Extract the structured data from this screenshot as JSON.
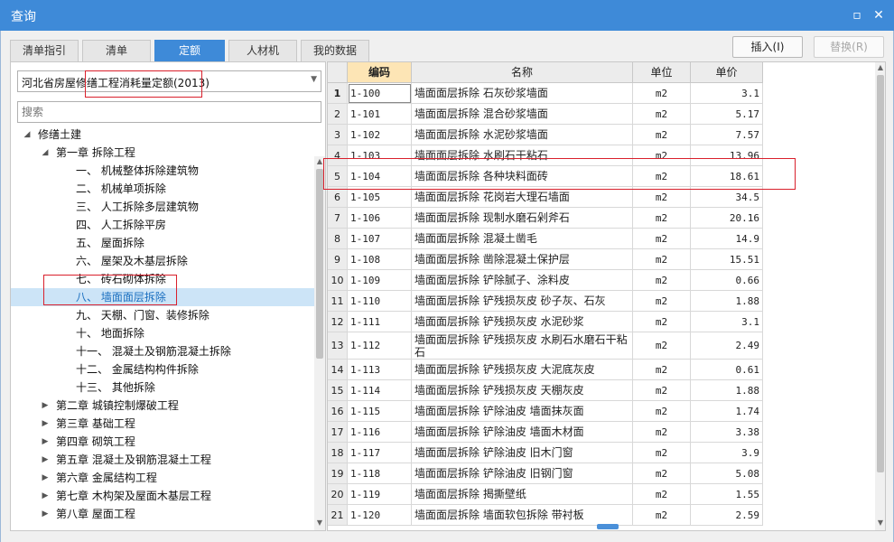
{
  "window": {
    "title": "查询",
    "restore_glyph": "▫",
    "close_glyph": "✕"
  },
  "tabs": [
    {
      "label": "清单指引",
      "active": false
    },
    {
      "label": "清单",
      "active": false
    },
    {
      "label": "定额",
      "active": true
    },
    {
      "label": "人材机",
      "active": false
    },
    {
      "label": "我的数据",
      "active": false
    }
  ],
  "actions": {
    "insert_label": "插入(I)",
    "replace_label": "替换(R)"
  },
  "left": {
    "quota_select": "河北省房屋修缮工程消耗量定额(2013)",
    "search_placeholder": "搜索",
    "tree": [
      {
        "label": "修缮土建",
        "level": 0,
        "expander": "◢"
      },
      {
        "label": "第一章 拆除工程",
        "level": 1,
        "expander": "◢"
      },
      {
        "label": "一、 机械整体拆除建筑物",
        "level": 2,
        "expander": ""
      },
      {
        "label": "二、 机械单项拆除",
        "level": 2,
        "expander": ""
      },
      {
        "label": "三、 人工拆除多层建筑物",
        "level": 2,
        "expander": ""
      },
      {
        "label": "四、 人工拆除平房",
        "level": 2,
        "expander": ""
      },
      {
        "label": "五、 屋面拆除",
        "level": 2,
        "expander": ""
      },
      {
        "label": "六、 屋架及木基层拆除",
        "level": 2,
        "expander": ""
      },
      {
        "label": "七、 砖石砌体拆除",
        "level": 2,
        "expander": ""
      },
      {
        "label": "八、 墙面面层拆除",
        "level": 2,
        "expander": "",
        "selected": true
      },
      {
        "label": "九、 天棚、门窗、装修拆除",
        "level": 2,
        "expander": ""
      },
      {
        "label": "十、 地面拆除",
        "level": 2,
        "expander": ""
      },
      {
        "label": "十一、 混凝土及钢筋混凝土拆除",
        "level": 2,
        "expander": ""
      },
      {
        "label": "十二、 金属结构构件拆除",
        "level": 2,
        "expander": ""
      },
      {
        "label": "十三、 其他拆除",
        "level": 2,
        "expander": ""
      },
      {
        "label": "第二章 城镇控制爆破工程",
        "level": 1,
        "expander": "▶"
      },
      {
        "label": "第三章 基础工程",
        "level": 1,
        "expander": "▶"
      },
      {
        "label": "第四章 砌筑工程",
        "level": 1,
        "expander": "▶"
      },
      {
        "label": "第五章 混凝土及钢筋混凝土工程",
        "level": 1,
        "expander": "▶"
      },
      {
        "label": "第六章 金属结构工程",
        "level": 1,
        "expander": "▶"
      },
      {
        "label": "第七章 木构架及屋面木基层工程",
        "level": 1,
        "expander": "▶"
      },
      {
        "label": "第八章 屋面工程",
        "level": 1,
        "expander": "▶"
      }
    ]
  },
  "grid": {
    "headers": {
      "code": "编码",
      "name": "名称",
      "unit": "单位",
      "price": "单价"
    },
    "rows": [
      {
        "n": "1",
        "code": "1-100",
        "name": "墙面面层拆除 石灰砂浆墙面",
        "unit": "m2",
        "price": "3.1"
      },
      {
        "n": "2",
        "code": "1-101",
        "name": "墙面面层拆除 混合砂浆墙面",
        "unit": "m2",
        "price": "5.17"
      },
      {
        "n": "3",
        "code": "1-102",
        "name": "墙面面层拆除 水泥砂浆墙面",
        "unit": "m2",
        "price": "7.57"
      },
      {
        "n": "4",
        "code": "1-103",
        "name": "墙面面层拆除 水刷石干粘石",
        "unit": "m2",
        "price": "13.96"
      },
      {
        "n": "5",
        "code": "1-104",
        "name": "墙面面层拆除 各种块料面砖",
        "unit": "m2",
        "price": "18.61"
      },
      {
        "n": "6",
        "code": "1-105",
        "name": "墙面面层拆除 花岗岩大理石墙面",
        "unit": "m2",
        "price": "34.5"
      },
      {
        "n": "7",
        "code": "1-106",
        "name": "墙面面层拆除 现制水磨石剁斧石",
        "unit": "m2",
        "price": "20.16"
      },
      {
        "n": "8",
        "code": "1-107",
        "name": "墙面面层拆除 混凝土凿毛",
        "unit": "m2",
        "price": "14.9"
      },
      {
        "n": "9",
        "code": "1-108",
        "name": "墙面面层拆除 凿除混凝土保护层",
        "unit": "m2",
        "price": "15.51"
      },
      {
        "n": "10",
        "code": "1-109",
        "name": "墙面面层拆除 铲除腻子、涂料皮",
        "unit": "m2",
        "price": "0.66"
      },
      {
        "n": "11",
        "code": "1-110",
        "name": "墙面面层拆除 铲残损灰皮 砂子灰、石灰",
        "unit": "m2",
        "price": "1.88"
      },
      {
        "n": "12",
        "code": "1-111",
        "name": "墙面面层拆除 铲残损灰皮 水泥砂浆",
        "unit": "m2",
        "price": "3.1"
      },
      {
        "n": "13",
        "code": "1-112",
        "name": "墙面面层拆除 铲残损灰皮 水刷石水磨石干粘石",
        "unit": "m2",
        "price": "2.49",
        "tall": true
      },
      {
        "n": "14",
        "code": "1-113",
        "name": "墙面面层拆除 铲残损灰皮 大泥底灰皮",
        "unit": "m2",
        "price": "0.61"
      },
      {
        "n": "15",
        "code": "1-114",
        "name": "墙面面层拆除 铲残损灰皮 天棚灰皮",
        "unit": "m2",
        "price": "1.88"
      },
      {
        "n": "16",
        "code": "1-115",
        "name": "墙面面层拆除 铲除油皮 墙面抹灰面",
        "unit": "m2",
        "price": "1.74"
      },
      {
        "n": "17",
        "code": "1-116",
        "name": "墙面面层拆除 铲除油皮 墙面木材面",
        "unit": "m2",
        "price": "3.38"
      },
      {
        "n": "18",
        "code": "1-117",
        "name": "墙面面层拆除 铲除油皮 旧木门窗",
        "unit": "m2",
        "price": "3.9"
      },
      {
        "n": "19",
        "code": "1-118",
        "name": "墙面面层拆除 铲除油皮 旧钢门窗",
        "unit": "m2",
        "price": "5.08"
      },
      {
        "n": "20",
        "code": "1-119",
        "name": "墙面面层拆除 揭撕壁纸",
        "unit": "m2",
        "price": "1.55"
      },
      {
        "n": "21",
        "code": "1-120",
        "name": "墙面面层拆除 墙面软包拆除 带衬板",
        "unit": "m2",
        "price": "2.59"
      }
    ]
  },
  "colors": {
    "title_bar": "#3e8ad8",
    "accent": "#3e8ad8",
    "annotation": "#d9202c",
    "selected_row": "#cce4f7",
    "code_header": "#fde5b5"
  }
}
